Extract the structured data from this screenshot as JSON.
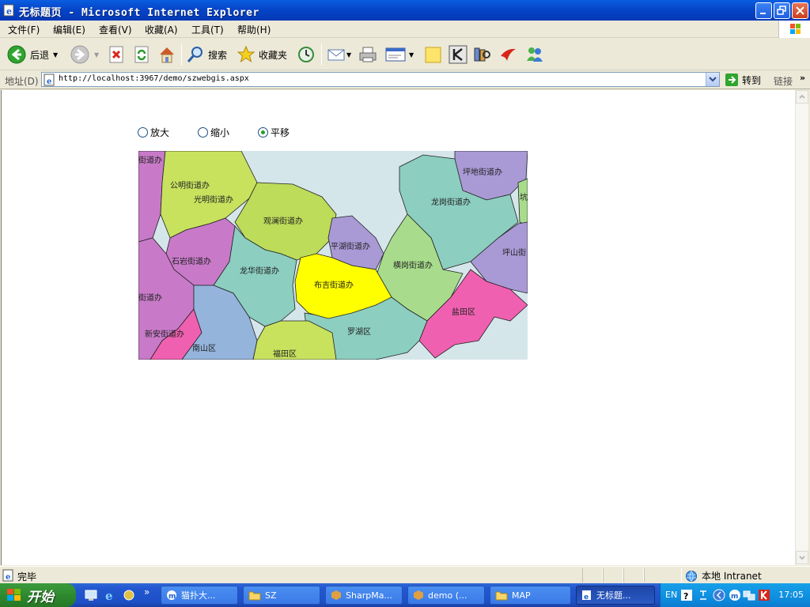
{
  "window": {
    "title": "无标题页 - Microsoft Internet Explorer"
  },
  "menu": {
    "items": [
      "文件(F)",
      "编辑(E)",
      "查看(V)",
      "收藏(A)",
      "工具(T)",
      "帮助(H)"
    ]
  },
  "toolbar": {
    "back_label": "后退",
    "search_label": "搜索",
    "favorites_label": "收藏夹"
  },
  "address": {
    "label": "地址(D)",
    "url": "http://localhost:3967/demo/szwebgis.aspx",
    "go_label": "转到",
    "links_label": "链接"
  },
  "page": {
    "radios": [
      {
        "label": "放大",
        "checked": false
      },
      {
        "label": "缩小",
        "checked": false
      },
      {
        "label": "平移",
        "checked": true
      }
    ]
  },
  "map": {
    "labels": [
      "街道办",
      "公明街道办",
      "光明街道办",
      "观澜街道办",
      "坪地街道办",
      "龙岗街道办",
      "坑",
      "平湖街道办",
      "横岗街道办",
      "坪山街",
      "石岩街道办",
      "龙华街道办",
      "布吉街道办",
      "盐田区",
      "街道办",
      "新安街道办",
      "南山区",
      "罗湖区",
      "福田区"
    ],
    "colors": {
      "water": "#d5e6ea",
      "green": "#c8e25e",
      "lime": "#bcdc5a",
      "purple": "#c87ac8",
      "lavender": "#a99ad6",
      "teal": "#8ccec0",
      "blue": "#94b4dc",
      "yellow": "#ffff00",
      "pink": "#f060b0",
      "lightgreen": "#a8dc8c"
    }
  },
  "status": {
    "text": "完毕",
    "zone": "本地 Intranet"
  },
  "taskbar": {
    "start_label": "开始",
    "tasks": [
      "猫扑大...",
      "SZ",
      "SharpMa...",
      "demo (...",
      "MAP",
      "无标题..."
    ],
    "tray_lang": "EN",
    "clock": "17:05"
  }
}
